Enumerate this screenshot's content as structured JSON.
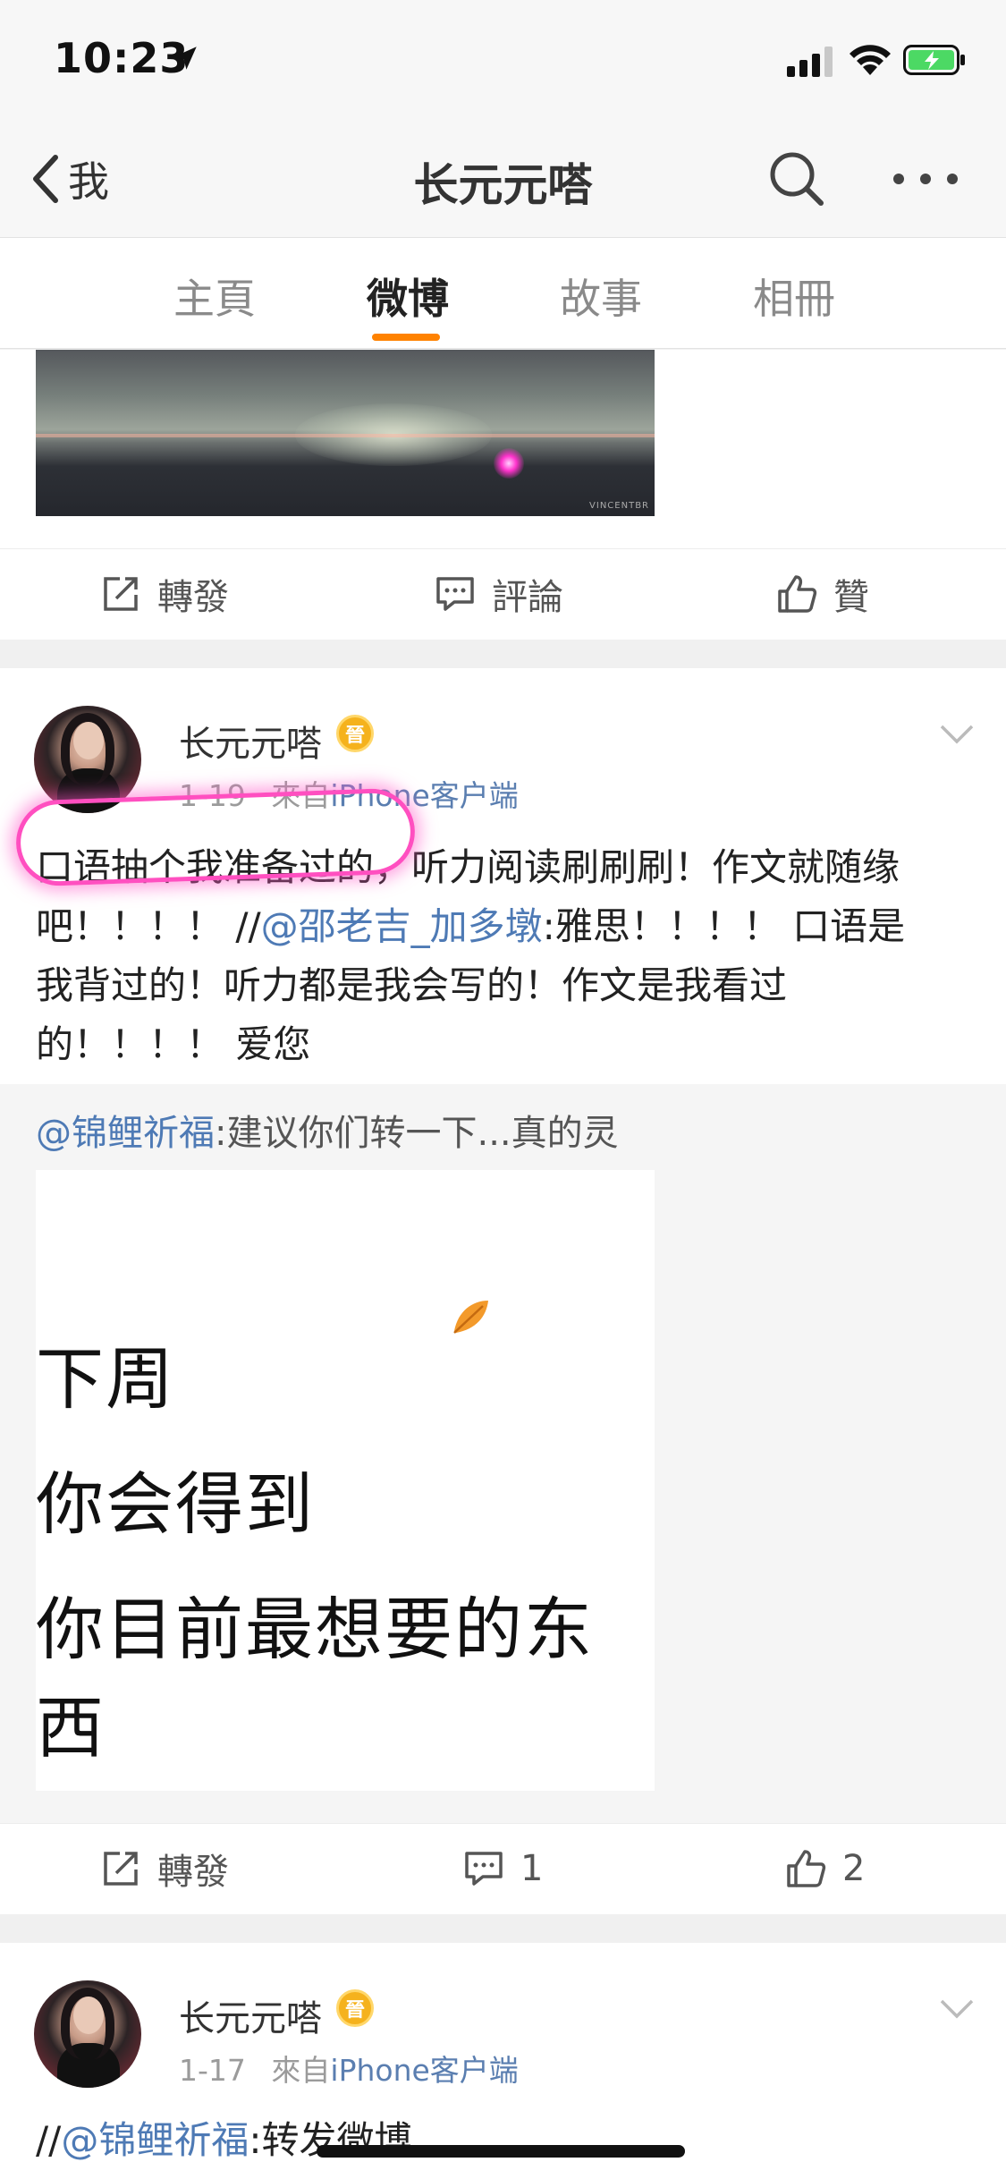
{
  "status_bar": {
    "time": "10:23"
  },
  "nav": {
    "back_label": "我",
    "title": "长元元嗒"
  },
  "tabs": [
    {
      "label": "主頁",
      "active": false
    },
    {
      "label": "微博",
      "active": true
    },
    {
      "label": "故事",
      "active": false
    },
    {
      "label": "相冊",
      "active": false
    }
  ],
  "accent_color": "#ff8200",
  "mention_color": "#4e7ab5",
  "post_prev": {
    "actions": {
      "repost": "轉發",
      "comment": "評論",
      "like": "贊"
    }
  },
  "post_1": {
    "author": "长元元嗒",
    "vip_badge": "晉",
    "date": "1-19",
    "from_prefix": "來自",
    "source": "iPhone客户端",
    "text_line1": "口语抽个我准备过的，听力阅读刷刷刷！作文就随缘",
    "text_line2_prefix": "吧！！！！ //",
    "text_mention": "@邵老吉_加多墩",
    "text_line2_suffix": ":雅思！！！！ 口语是",
    "text_line3": "我背过的！听力都是我会写的！作文是我看过",
    "text_line4": "的！！！！ 爱您",
    "repost": {
      "mention": "@锦鲤祈福",
      "text": ":建议你们转一下...真的灵",
      "image_lines": [
        "下周",
        "你会得到",
        "你目前最想要的东西"
      ]
    },
    "actions": {
      "repost": "轉發",
      "comment_count": "1",
      "like_count": "2"
    }
  },
  "post_2": {
    "author": "长元元嗒",
    "vip_badge": "晉",
    "date": "1-17",
    "from_prefix": "來自",
    "source": "iPhone客户端",
    "text_prefix": "//",
    "text_mention": "@锦鲤祈福",
    "text_suffix": ":转发微博"
  }
}
